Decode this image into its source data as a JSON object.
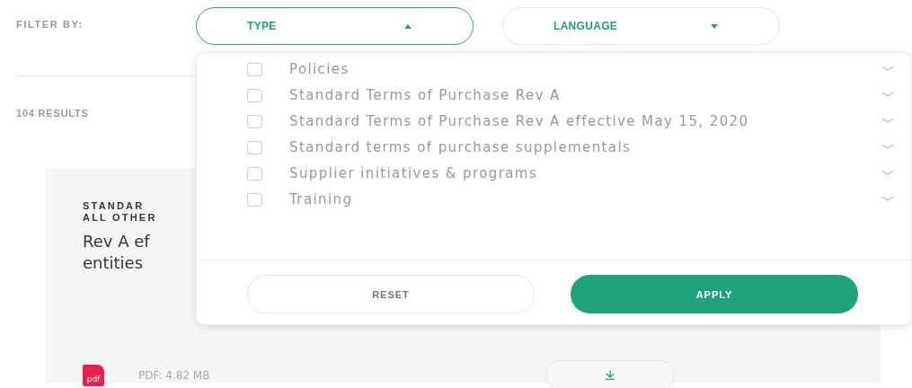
{
  "filter": {
    "label": "FILTER BY:",
    "dropdowns": [
      {
        "label": "TYPE",
        "expanded": true
      },
      {
        "label": "LANGUAGE",
        "expanded": false
      }
    ]
  },
  "results_count": "104 RESULTS",
  "type_menu": {
    "options": [
      {
        "label": "Policies",
        "checked": false
      },
      {
        "label": "Standard Terms of Purchase Rev A",
        "checked": false
      },
      {
        "label": "Standard Terms of Purchase Rev A effective May 15, 2020",
        "checked": false
      },
      {
        "label": "Standard terms of purchase supplementals",
        "checked": false
      },
      {
        "label": "Supplier initiatives & programs",
        "checked": false
      },
      {
        "label": "Training",
        "checked": false
      }
    ],
    "buttons": [
      {
        "label": "RESET",
        "kind": "secondary"
      },
      {
        "label": "APPLY",
        "kind": "primary"
      }
    ]
  },
  "card": {
    "eyebrow_lines": [
      "STANDAR",
      "ALL OTHER"
    ],
    "title_lines": [
      "Rev A ef",
      "entities"
    ],
    "file_type": "pdf",
    "file_info": "PDF: 4.82 MB"
  }
}
